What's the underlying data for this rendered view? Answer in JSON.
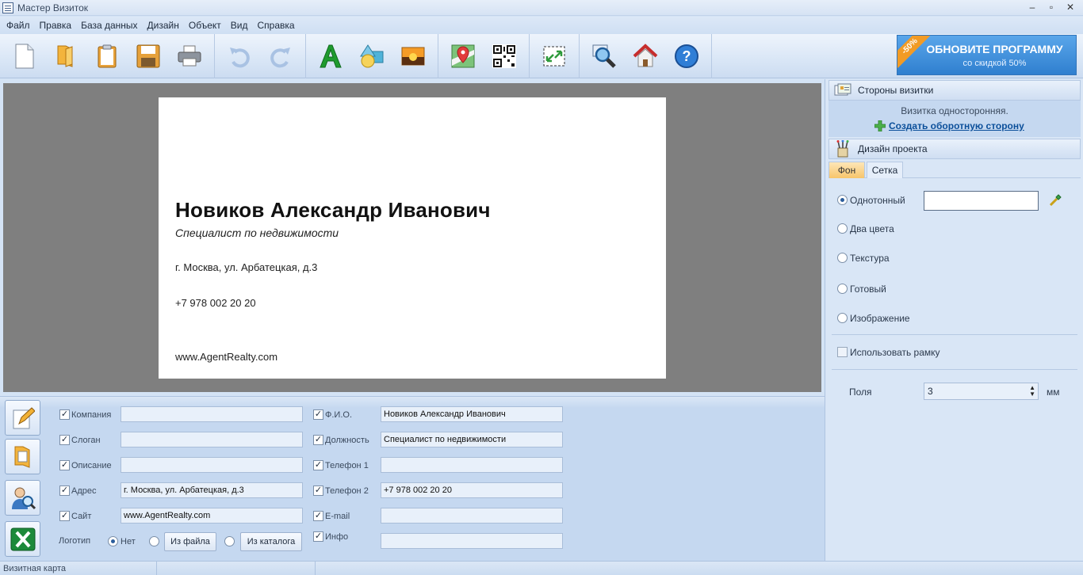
{
  "window": {
    "title": "Мастер Визиток"
  },
  "menu": [
    "Файл",
    "Правка",
    "База данных",
    "Дизайн",
    "Объект",
    "Вид",
    "Справка"
  ],
  "upgrade": {
    "ribbon": "-50%",
    "title": "ОБНОВИТЕ ПРОГРАММУ",
    "subtitle": "со скидкой 50%"
  },
  "card": {
    "name": "Новиков Александр Иванович",
    "position": "Специалист по недвижимости",
    "address": "г. Москва, ул. Арбатецкая, д.3",
    "phone": "+7 978 002 20 20",
    "site": "www.AgentRealty.com"
  },
  "form": {
    "company_label": "Компания",
    "company_value": "",
    "slogan_label": "Слоган",
    "slogan_value": "",
    "description_label": "Описание",
    "description_value": "",
    "address_label": "Адрес",
    "address_value": "г. Москва, ул. Арбатецкая, д.3",
    "site_label": "Сайт",
    "site_value": "www.AgentRealty.com",
    "fio_label": "Ф.И.О.",
    "fio_value": "Новиков Александр Иванович",
    "post_label": "Должность",
    "post_value": "Специалист по недвижимости",
    "phone1_label": "Телефон 1",
    "phone1_value": "",
    "phone2_label": "Телефон 2",
    "phone2_value": "+7 978 002 20 20",
    "email_label": "E-mail",
    "email_value": "",
    "info_label": "Инфо",
    "info_value": "",
    "logo_label": "Логотип",
    "logo_none": "Нет",
    "logo_from_file": "Из файла",
    "logo_from_catalog": "Из каталога"
  },
  "sides": {
    "title": "Стороны визитки",
    "status": "Визитка односторонняя.",
    "create_back": "Создать оборотную сторону"
  },
  "design": {
    "title": "Дизайн проекта",
    "tab_background": "Фон",
    "tab_grid": "Сетка",
    "opt_solid": "Однотонный",
    "opt_two_colors": "Два цвета",
    "opt_texture": "Текстура",
    "opt_ready": "Готовый",
    "opt_image": "Изображение",
    "use_frame": "Использовать рамку",
    "margins_label": "Поля",
    "margins_value": "3",
    "margins_unit": "мм"
  },
  "status": {
    "text": "Визитная карта"
  }
}
